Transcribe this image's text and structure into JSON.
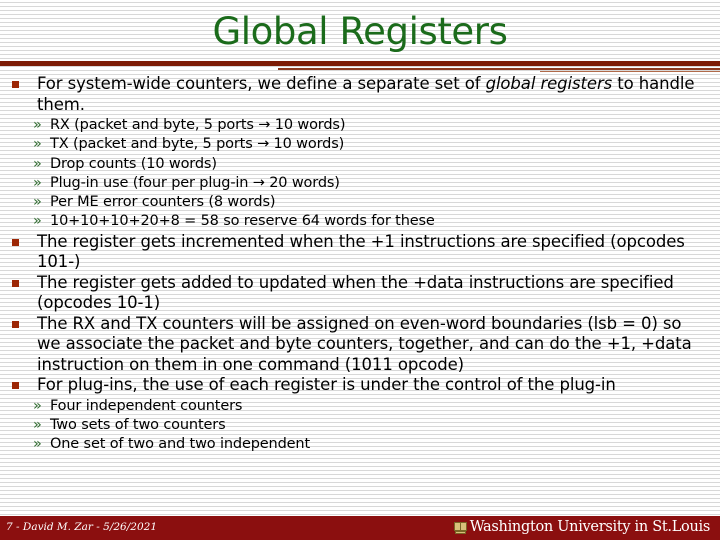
{
  "slide": {
    "title": "Global Registers",
    "title_color": "#1b6b1b",
    "rule_color": "#7d1c06",
    "bullet_marker_color": "#9c2706",
    "subbullet_marker_color": "#2f6b2f",
    "subbullet_marker": "»",
    "background_color": "#ffffff"
  },
  "content": {
    "bullets": [
      {
        "text_before_italic": "For system-wide counters, we define a separate set of ",
        "italic_text": "global registers",
        "text_after_italic": " to handle them.",
        "subbullets": [
          "RX (packet and byte, 5 ports → 10 words)",
          "TX (packet and byte, 5 ports → 10 words)",
          "Drop counts (10 words)",
          "Plug-in use (four per plug-in → 20 words)",
          "Per ME error counters (8 words)",
          "10+10+10+20+8 = 58 so reserve 64 words for these"
        ]
      },
      {
        "text": "The register gets incremented when the +1 instructions are specified (opcodes 101-)",
        "subbullets": []
      },
      {
        "text": "The register gets added to updated when the +data instructions are specified (opcodes 10-1)",
        "subbullets": []
      },
      {
        "text": "The RX and TX counters will be assigned on even-word boundaries (lsb = 0) so we associate the packet and byte counters, together, and can do the +1, +data instruction on them in one command (1011 opcode)",
        "subbullets": []
      },
      {
        "text": "For plug-ins, the use of each register is under the control of the plug-in",
        "subbullets": [
          "Four independent counters",
          "Two sets of two counters",
          "One set of two and two independent"
        ]
      }
    ]
  },
  "footer": {
    "left_text": "7 - David M. Zar - 5/26/2021",
    "logo_text": "Washington University in St.Louis",
    "bar_color": "#8b0f0f"
  }
}
